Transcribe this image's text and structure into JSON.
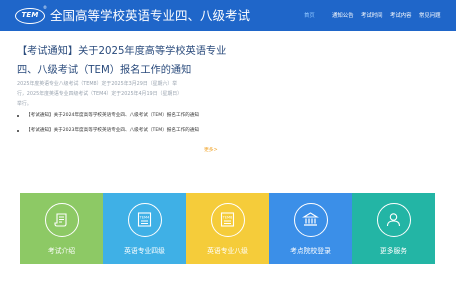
{
  "header": {
    "logo_text": "TEM",
    "logo_mark": "®",
    "title": "全国高等学校英语专业四、八级考试",
    "nav": [
      {
        "label": "首页",
        "active": true
      },
      {
        "label": "通知公告",
        "active": false
      },
      {
        "label": "考试时间",
        "active": false
      },
      {
        "label": "考试内容",
        "active": false
      },
      {
        "label": "常见问题",
        "active": false
      }
    ],
    "colors": {
      "bar": "#1f66c9",
      "active_nav": "#8fc6ff"
    }
  },
  "notice": {
    "title_line1": "【考试通知】关于2025年度高等学校英语专业",
    "title_line2": "四、八级考试（TEM）报名工作的通知",
    "body_line1": "2025年度英语专业八级考试（TEM8）定于2025年3月29日（星期六）举",
    "body_line2": "行，2025年度英语专业四级考试（TEM4）定于2025年4月19日（星期日）",
    "body_line3": "举行。"
  },
  "links": [
    "【考试通知】关于2024年度高等学校英语专业四、八级考试（TEM）报名工作的通知",
    "【考试通知】关于2023年度高等学校英语专业四、八级考试（TEM）报名工作的通知"
  ],
  "more_label": "更多>",
  "tiles": [
    {
      "label": "考试介绍",
      "icon": "scroll-icon",
      "color": "#8dc965"
    },
    {
      "label": "英语专业四级",
      "icon": "tem4-document-icon",
      "color": "#3fb0e6"
    },
    {
      "label": "英语专业八级",
      "icon": "tem8-document-icon",
      "color": "#f5cc3a"
    },
    {
      "label": "考点院校登录",
      "icon": "institution-building-icon",
      "color": "#3b8fe8"
    },
    {
      "label": "更多服务",
      "icon": "user-icon",
      "color": "#23b5a5"
    }
  ]
}
